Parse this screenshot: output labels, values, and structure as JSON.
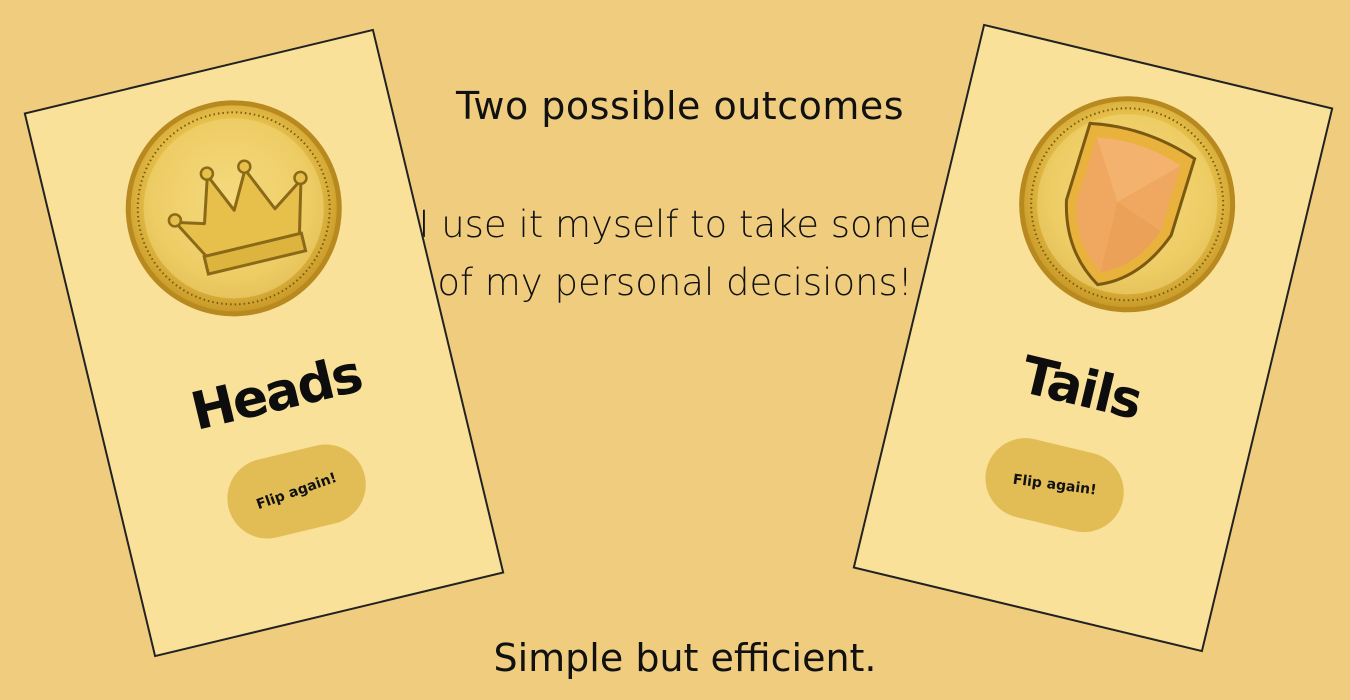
{
  "intro": {
    "headline": "Two possible outcomes",
    "description": "I use it myself to take some of my personal decisions!",
    "tagline": "Simple but efficient."
  },
  "cards": {
    "heads": {
      "result_label": "Heads",
      "button_label": "Flip again!",
      "coin_icon": "crown-icon"
    },
    "tails": {
      "result_label": "Tails",
      "button_label": "Flip again!",
      "coin_icon": "shield-icon"
    }
  },
  "colors": {
    "background": "#f0cd7e",
    "card": "#f9e19a",
    "button": "#e2bd55",
    "coin_gold": "#e8c24e",
    "shield_orange": "#f0a860"
  }
}
